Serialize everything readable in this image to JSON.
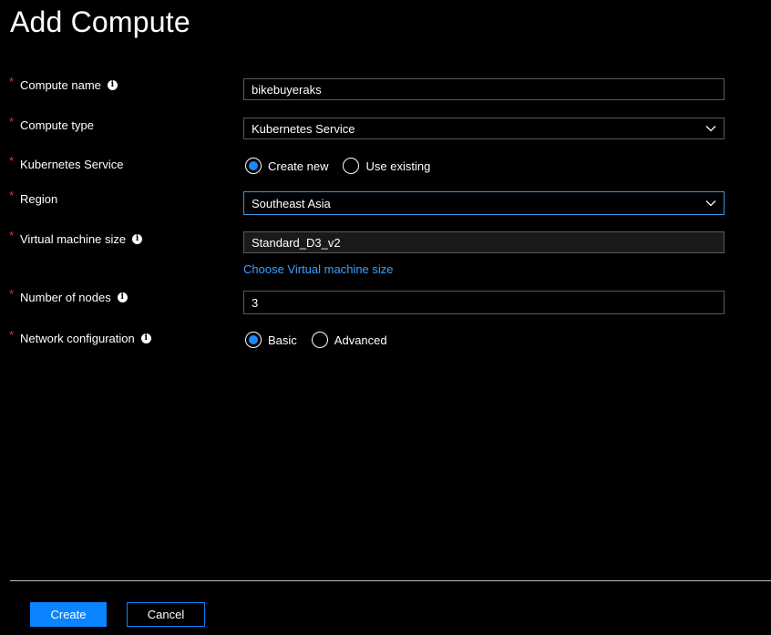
{
  "title": "Add Compute",
  "form": {
    "compute_name": {
      "label": "Compute name",
      "value": "bikebuyeraks"
    },
    "compute_type": {
      "label": "Compute type",
      "value": "Kubernetes Service"
    },
    "kubernetes_service": {
      "label": "Kubernetes Service",
      "options": [
        "Create new",
        "Use existing"
      ],
      "selected": "Create new"
    },
    "region": {
      "label": "Region",
      "value": "Southeast Asia"
    },
    "vm_size": {
      "label": "Virtual machine size",
      "value": "Standard_D3_v2",
      "link": "Choose Virtual machine size"
    },
    "nodes": {
      "label": "Number of nodes",
      "value": "3"
    },
    "network": {
      "label": "Network configuration",
      "options": [
        "Basic",
        "Advanced"
      ],
      "selected": "Basic"
    },
    "required_marker": "*",
    "info_glyph": "i"
  },
  "footer": {
    "create_label": "Create",
    "cancel_label": "Cancel"
  },
  "colors": {
    "background": "#000000",
    "accent": "#0a84ff",
    "required": "#e0333a",
    "link": "#3aa0ff",
    "focus_border": "#3a96dd"
  },
  "icons": {
    "info": "info-icon",
    "dropdown": "chevron-down-icon"
  }
}
